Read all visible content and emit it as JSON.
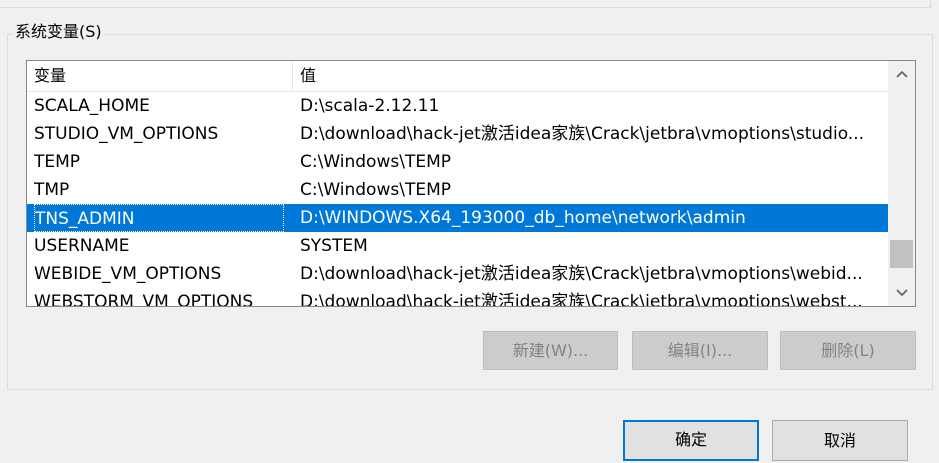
{
  "group": {
    "title": "系统变量(S)"
  },
  "table": {
    "headers": {
      "name": "变量",
      "value": "值"
    },
    "rows": [
      {
        "name": "SCALA_HOME",
        "value": "D:\\scala-2.12.11"
      },
      {
        "name": "STUDIO_VM_OPTIONS",
        "value": "D:\\download\\hack-jet激活idea家族\\Crack\\jetbra\\vmoptions\\studio..."
      },
      {
        "name": "TEMP",
        "value": "C:\\Windows\\TEMP"
      },
      {
        "name": "TMP",
        "value": "C:\\Windows\\TEMP"
      },
      {
        "name": "TNS_ADMIN",
        "value": "D:\\WINDOWS.X64_193000_db_home\\network\\admin"
      },
      {
        "name": "USERNAME",
        "value": "SYSTEM"
      },
      {
        "name": "WEBIDE_VM_OPTIONS",
        "value": "D:\\download\\hack-jet激活idea家族\\Crack\\jetbra\\vmoptions\\webid..."
      },
      {
        "name": "WEBSTORM_VM_OPTIONS",
        "value": "D:\\download\\hack-jet激活idea家族\\Crack\\jetbra\\vmoptions\\webst..."
      }
    ],
    "selected_row": "TNS_ADMIN"
  },
  "actions": {
    "new": "新建(W)...",
    "edit": "编辑(I)...",
    "delete": "删除(L)"
  },
  "dialog": {
    "ok": "确定",
    "cancel": "取消"
  },
  "icons": {
    "scroll_up": "chevron-up-icon",
    "scroll_down": "chevron-down-icon"
  },
  "colors": {
    "selection": "#0078d7",
    "focus_border": "#0078d7"
  }
}
